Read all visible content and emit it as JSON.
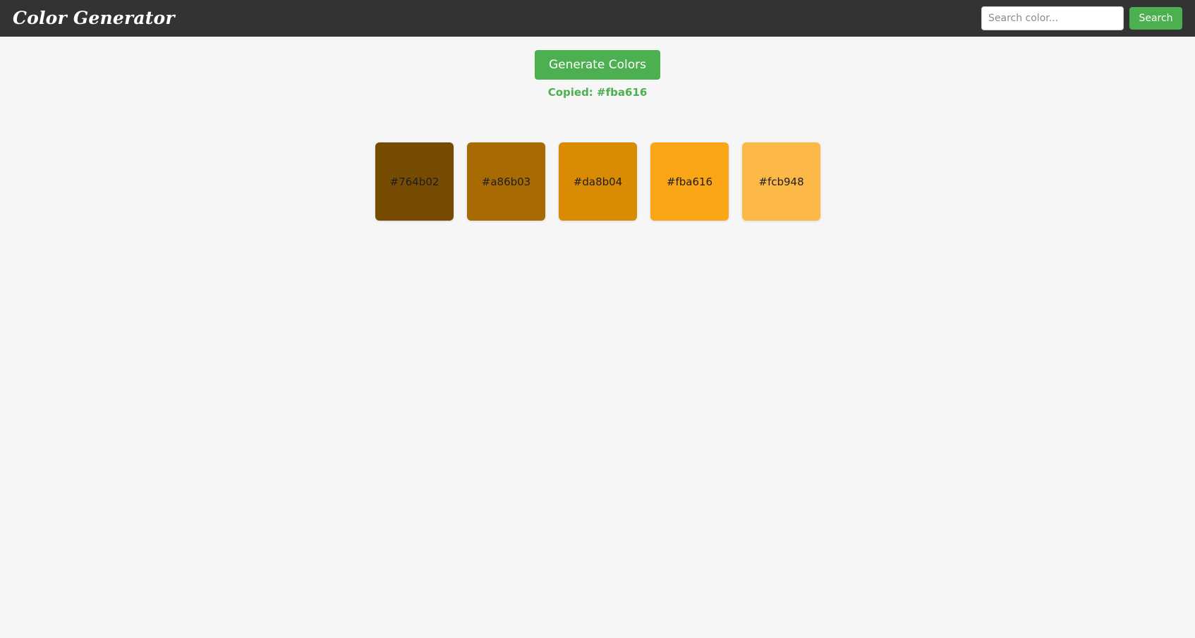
{
  "header": {
    "title": "Color Generator",
    "search": {
      "placeholder": "Search color...",
      "value": "",
      "button_label": "Search"
    }
  },
  "main": {
    "generate_label": "Generate Colors",
    "status": "Copied: #fba616",
    "colors": [
      {
        "hex": "#764b02",
        "label": "#764b02"
      },
      {
        "hex": "#a86b03",
        "label": "#a86b03"
      },
      {
        "hex": "#da8b04",
        "label": "#da8b04"
      },
      {
        "hex": "#fba616",
        "label": "#fba616"
      },
      {
        "hex": "#fcb948",
        "label": "#fcb948"
      }
    ]
  },
  "theme": {
    "header_bg": "#333333",
    "page_bg": "#f6f6f6",
    "accent": "#4caf50"
  }
}
